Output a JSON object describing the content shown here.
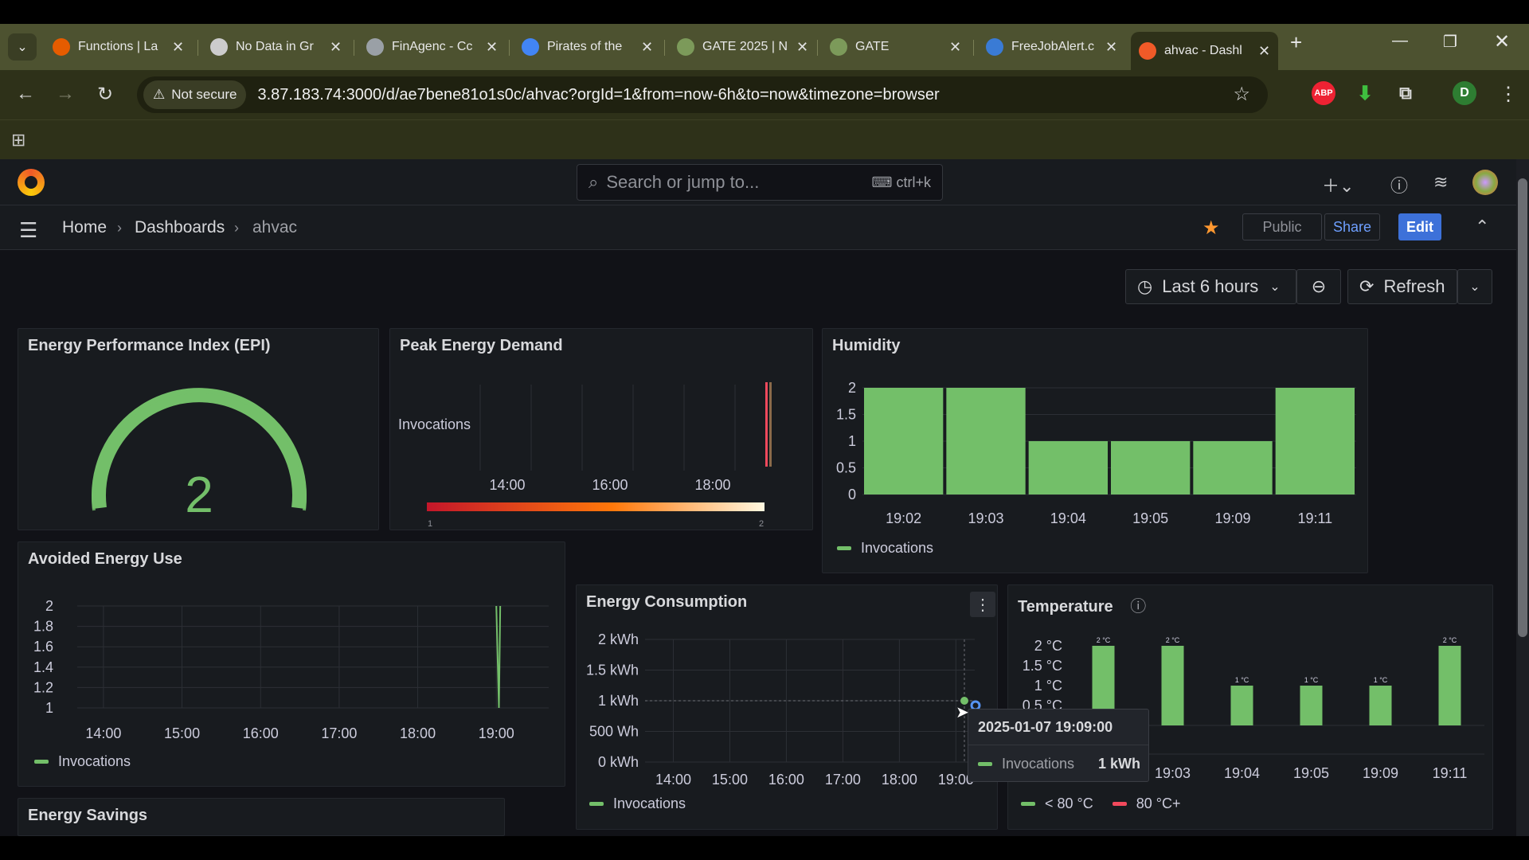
{
  "browser": {
    "tabs": [
      {
        "title": "Functions | La",
        "color": "#e65c00"
      },
      {
        "title": "No Data in Gr",
        "color": "#cccccc"
      },
      {
        "title": "FinAgenc - Cc",
        "color": "#9aa0a6"
      },
      {
        "title": "Pirates of the",
        "color": "#4285f4"
      },
      {
        "title": "GATE 2025 | N",
        "color": "#7c9a5a"
      },
      {
        "title": "GATE",
        "color": "#7c9a5a"
      },
      {
        "title": "FreeJobAlert.c",
        "color": "#3a7bd5"
      },
      {
        "title": "ahvac - Dashl",
        "color": "#f05a28"
      }
    ],
    "not_secure": "Not secure",
    "url": "3.87.183.74:3000/d/ae7bene81o1s0c/ahvac?orgId=1&from=now-6h&to=now&timezone=browser",
    "profile_initial": "D",
    "abp_label": "ABP"
  },
  "grafana": {
    "search_placeholder": "Search or jump to...",
    "search_shortcut": "ctrl+k",
    "breadcrumb": [
      "Home",
      "Dashboards",
      "ahvac"
    ],
    "public_label": "Public",
    "share_label": "Share",
    "edit_label": "Edit",
    "time_range": "Last 6 hours",
    "refresh_label": "Refresh"
  },
  "panels": {
    "epi": {
      "title": "Energy Performance Index (EPI)",
      "value": "2",
      "gauge_fraction": 1.0,
      "color": "#73bf69"
    },
    "peak": {
      "title": "Peak Energy Demand",
      "row_label": "Invocations",
      "x_ticks": [
        "14:00",
        "16:00",
        "18:00"
      ],
      "scale_min": "1",
      "scale_max": "2"
    },
    "avoided": {
      "title": "Avoided Energy Use",
      "legend": "Invocations"
    },
    "consumption": {
      "title": "Energy Consumption",
      "legend": "Invocations"
    },
    "temperature": {
      "title": "Temperature",
      "legend_low": "< 80 °C",
      "legend_high": "80 °C+"
    },
    "humidity": {
      "title": "Humidity",
      "legend": "Invocations"
    },
    "savings": {
      "title": "Energy Savings"
    }
  },
  "tooltip": {
    "time": "2025-01-07 19:09:00",
    "series": "Invocations",
    "value": "1 kWh"
  },
  "chart_data": [
    {
      "id": "humidity",
      "type": "bar",
      "title": "Humidity",
      "categories": [
        "19:02",
        "19:03",
        "19:04",
        "19:05",
        "19:09",
        "19:11"
      ],
      "series": [
        {
          "name": "Invocations",
          "values": [
            2,
            2,
            1,
            1,
            1,
            2
          ]
        }
      ],
      "yticks": [
        "2",
        "1.5",
        "1",
        "0.5",
        "0"
      ],
      "ylim": [
        0,
        2
      ],
      "color": "#73bf69"
    },
    {
      "id": "avoided",
      "type": "line",
      "title": "Avoided Energy Use",
      "x_ticks": [
        "14:00",
        "15:00",
        "16:00",
        "17:00",
        "18:00",
        "19:00"
      ],
      "yticks": [
        "2",
        "1.8",
        "1.6",
        "1.4",
        "1.2",
        "1"
      ],
      "ylim": [
        1,
        2
      ],
      "series": [
        {
          "name": "Invocations",
          "points": [
            [
              "19:00",
              2
            ],
            [
              "19:02",
              1
            ],
            [
              "19:03",
              2
            ]
          ]
        }
      ],
      "color": "#73bf69"
    },
    {
      "id": "consumption",
      "type": "scatter",
      "title": "Energy Consumption",
      "x_ticks": [
        "14:00",
        "15:00",
        "16:00",
        "17:00",
        "18:00",
        "19:00"
      ],
      "yticks": [
        "2 kWh",
        "1.5 kWh",
        "1 kWh",
        "500 Wh",
        "0 kWh"
      ],
      "ylim": [
        0,
        2
      ],
      "series": [
        {
          "name": "Invocations",
          "points": [
            [
              "19:09",
              1
            ]
          ]
        }
      ],
      "color": "#73bf69"
    },
    {
      "id": "temperature",
      "type": "bar",
      "title": "Temperature",
      "categories": [
        "19:02",
        "19:03",
        "19:04",
        "19:05",
        "19:09",
        "19:11"
      ],
      "x_ticks": [
        "19:03",
        "19:04",
        "19:05",
        "19:09",
        "19:11"
      ],
      "series": [
        {
          "name": "Temperature",
          "values": [
            2,
            2,
            1,
            1,
            1,
            2
          ]
        }
      ],
      "bar_labels": [
        "2 °C",
        "2 °C",
        "1 °C",
        "1 °C",
        "1 °C",
        "2 °C"
      ],
      "yticks": [
        "2 °C",
        "1.5 °C",
        "1 °C",
        "0.5 °C"
      ],
      "ylim": [
        0,
        2
      ],
      "color": "#73bf69"
    }
  ]
}
